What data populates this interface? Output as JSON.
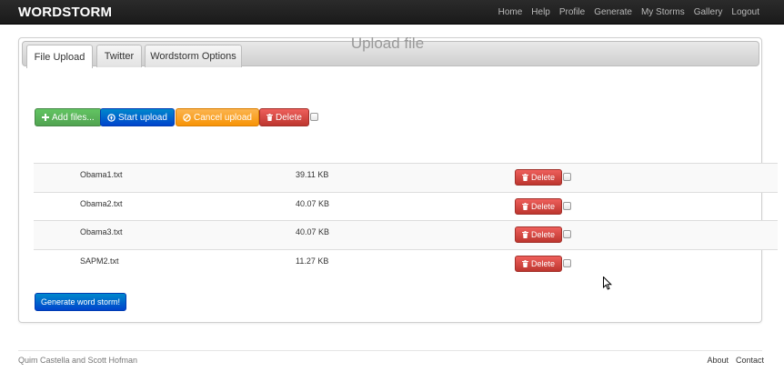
{
  "navbar": {
    "brand": "WORDSTORM",
    "links": [
      "Home",
      "Help",
      "Profile",
      "Generate",
      "My Storms",
      "Gallery",
      "Logout"
    ]
  },
  "tabs": [
    "File Upload",
    "Twitter",
    "Wordstorm Options"
  ],
  "upload": {
    "title": "Upload file",
    "add_files_label": "Add files...",
    "start_upload_label": "Start upload",
    "cancel_upload_label": "Cancel upload",
    "delete_label": "Delete",
    "icons": {
      "add": "plus-icon",
      "start": "upload-circle-icon",
      "cancel": "ban-icon",
      "delete": "trash-icon"
    }
  },
  "files": [
    {
      "name": "Obama1.txt",
      "size": "39.11 KB",
      "delete_label": "Delete"
    },
    {
      "name": "Obama2.txt",
      "size": "40.07 KB",
      "delete_label": "Delete"
    },
    {
      "name": "Obama3.txt",
      "size": "40.07 KB",
      "delete_label": "Delete"
    },
    {
      "name": "SAPM2.txt",
      "size": "11.27 KB",
      "delete_label": "Delete"
    }
  ],
  "generate_label": "Generate word storm!",
  "footer": {
    "credits": "Quim Castella and Scott Hofman",
    "links": [
      "About",
      "Contact"
    ]
  },
  "colors": {
    "navbar": "#1b1b1b",
    "success": "#5bb75b",
    "primary": "#0074cc",
    "warning": "#faa732",
    "danger": "#da4f49"
  }
}
